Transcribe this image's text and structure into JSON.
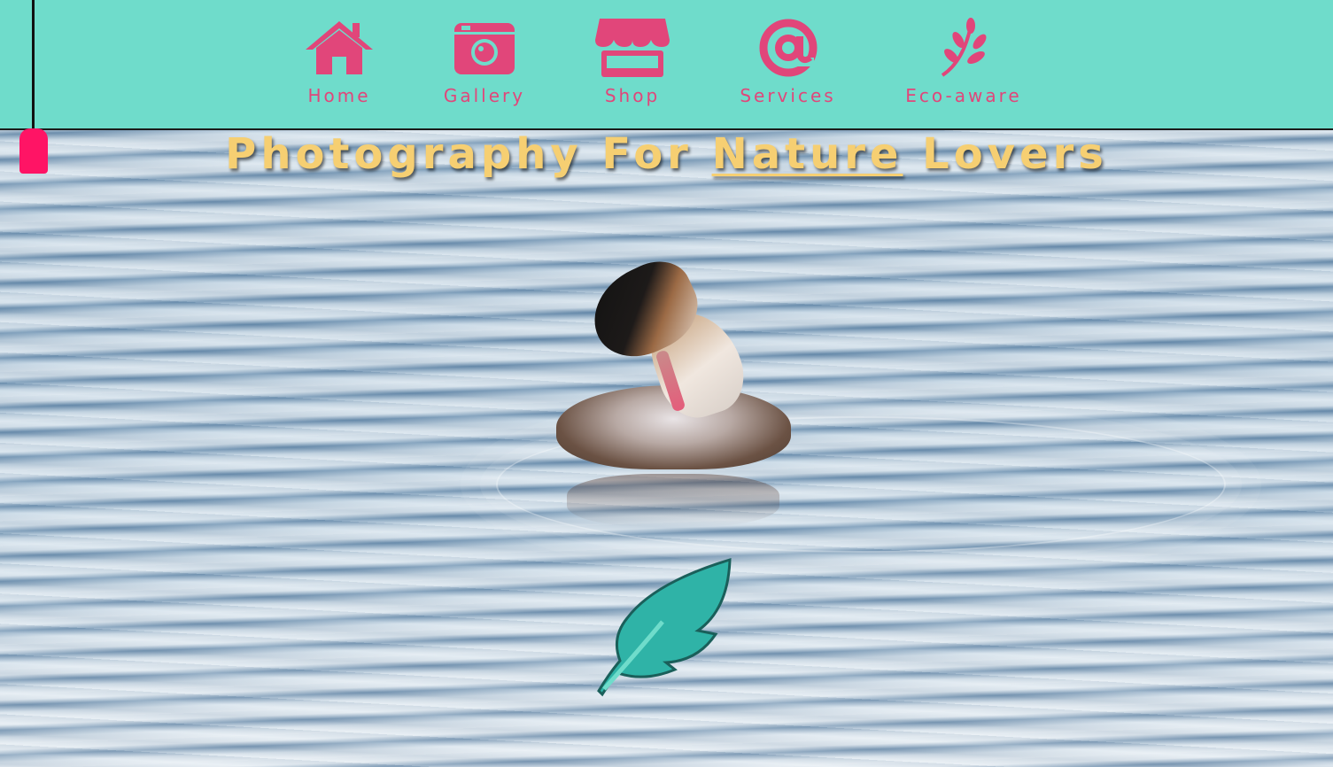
{
  "nav": {
    "items": [
      {
        "label": "Home",
        "icon": "home-icon"
      },
      {
        "label": "Gallery",
        "icon": "camera-icon"
      },
      {
        "label": "Shop",
        "icon": "store-icon"
      },
      {
        "label": "Services",
        "icon": "at-sign-icon"
      },
      {
        "label": "Eco-aware",
        "icon": "leaf-branch-icon"
      }
    ],
    "background_color": "#6fdccb",
    "accent_color": "#e1467a"
  },
  "hero": {
    "title_part1": "Photography For ",
    "title_highlight": "Nature",
    "title_part2": " Lovers",
    "title_color": "#f6cf72",
    "feather_icon": "feather-icon",
    "feather_color": "#2fb3a7"
  },
  "slider": {
    "handle_color": "#ff1465"
  }
}
